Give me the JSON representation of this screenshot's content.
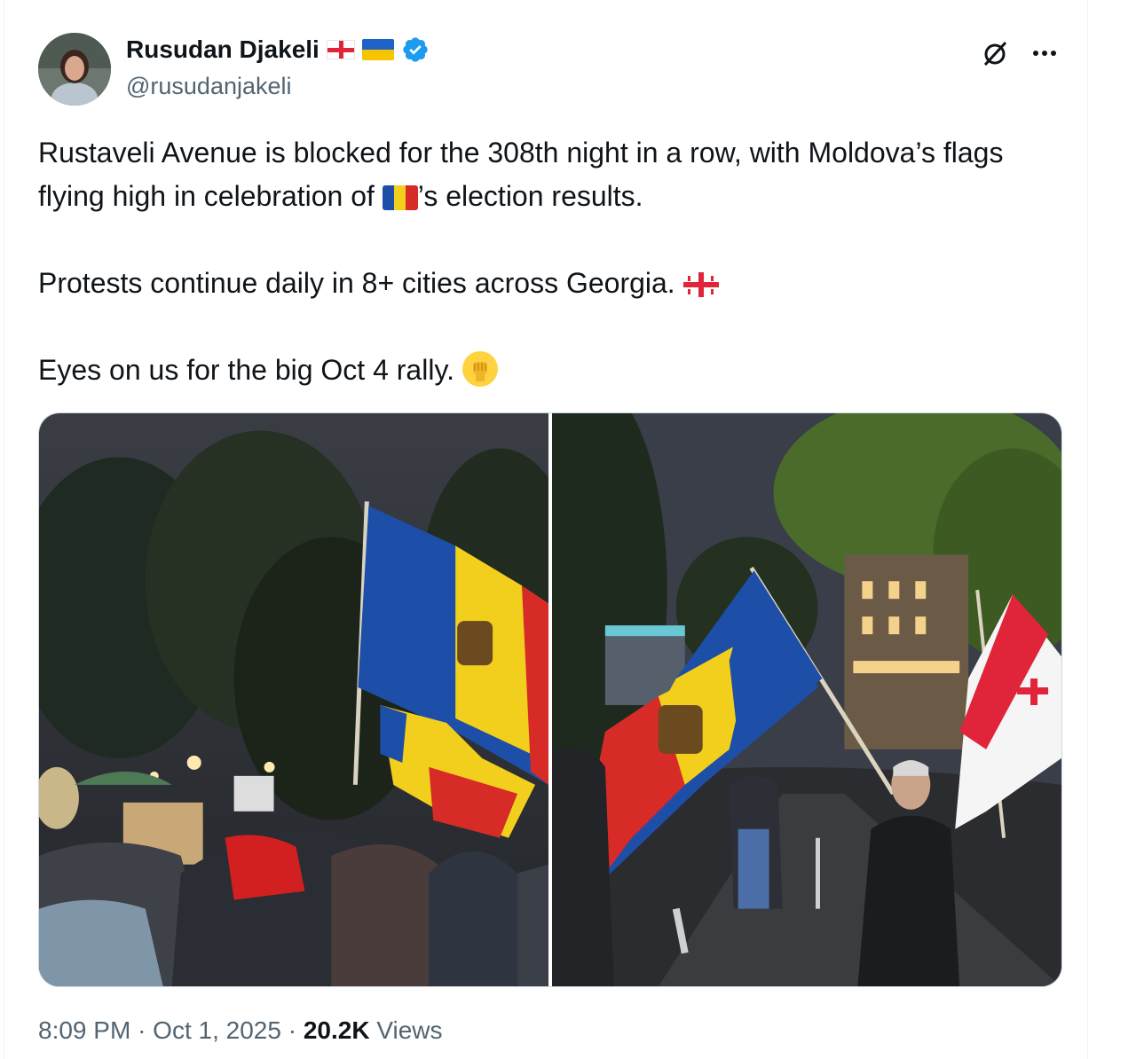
{
  "author": {
    "display_name": "Rusudan Djakeli",
    "handle": "@rusudanjakeli",
    "name_flags": [
      "georgia-flag-icon",
      "ukraine-flag-icon"
    ],
    "verified": true
  },
  "actions": {
    "grok_icon": "grok-icon",
    "more_icon": "more-icon"
  },
  "tweet": {
    "line1_part1": "Rustaveli Avenue is blocked for the 308th night in a row, with Moldova’s flags flying high in celebration of ",
    "line1_part2": "’s election results.",
    "line2": "Protests continue daily in 8+ cities across Georgia. ",
    "line3": "Eyes on us for the big Oct 4 rally. "
  },
  "media": [
    {
      "icon": "photo-protest-moldova-flag-crowd"
    },
    {
      "icon": "photo-protest-street-flags"
    }
  ],
  "footer": {
    "time": "8:09 PM",
    "separator": "·",
    "date": "Oct 1, 2025",
    "views_count": "20.2K",
    "views_label": "Views"
  },
  "colors": {
    "text": "#0f1419",
    "secondary": "#536471",
    "verified_blue": "#1d9bf0",
    "moldova_blue": "#1d4fa8",
    "moldova_yellow": "#f2cf1c",
    "moldova_red": "#d72b28",
    "georgia_red": "#e0243a"
  }
}
